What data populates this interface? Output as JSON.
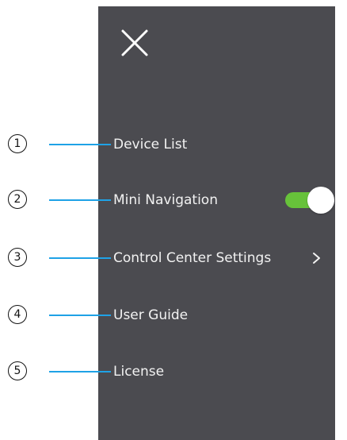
{
  "colors": {
    "panel_bg": "#4b4b50",
    "menu_text": "#f2f2f2",
    "toggle_on": "#67c23a",
    "callout_line": "#1fa2e6",
    "callout_text": "#111111"
  },
  "header": {
    "close_icon": "close-icon"
  },
  "menu": {
    "items": [
      {
        "label": "Device List"
      },
      {
        "label": "Mini Navigation",
        "toggle_on": true
      },
      {
        "label": "Control Center Settings",
        "icon": "chevron-right-icon"
      },
      {
        "label": "User Guide"
      },
      {
        "label": "License"
      }
    ]
  },
  "callouts": [
    {
      "number": "1"
    },
    {
      "number": "2"
    },
    {
      "number": "3"
    },
    {
      "number": "4"
    },
    {
      "number": "5"
    }
  ]
}
